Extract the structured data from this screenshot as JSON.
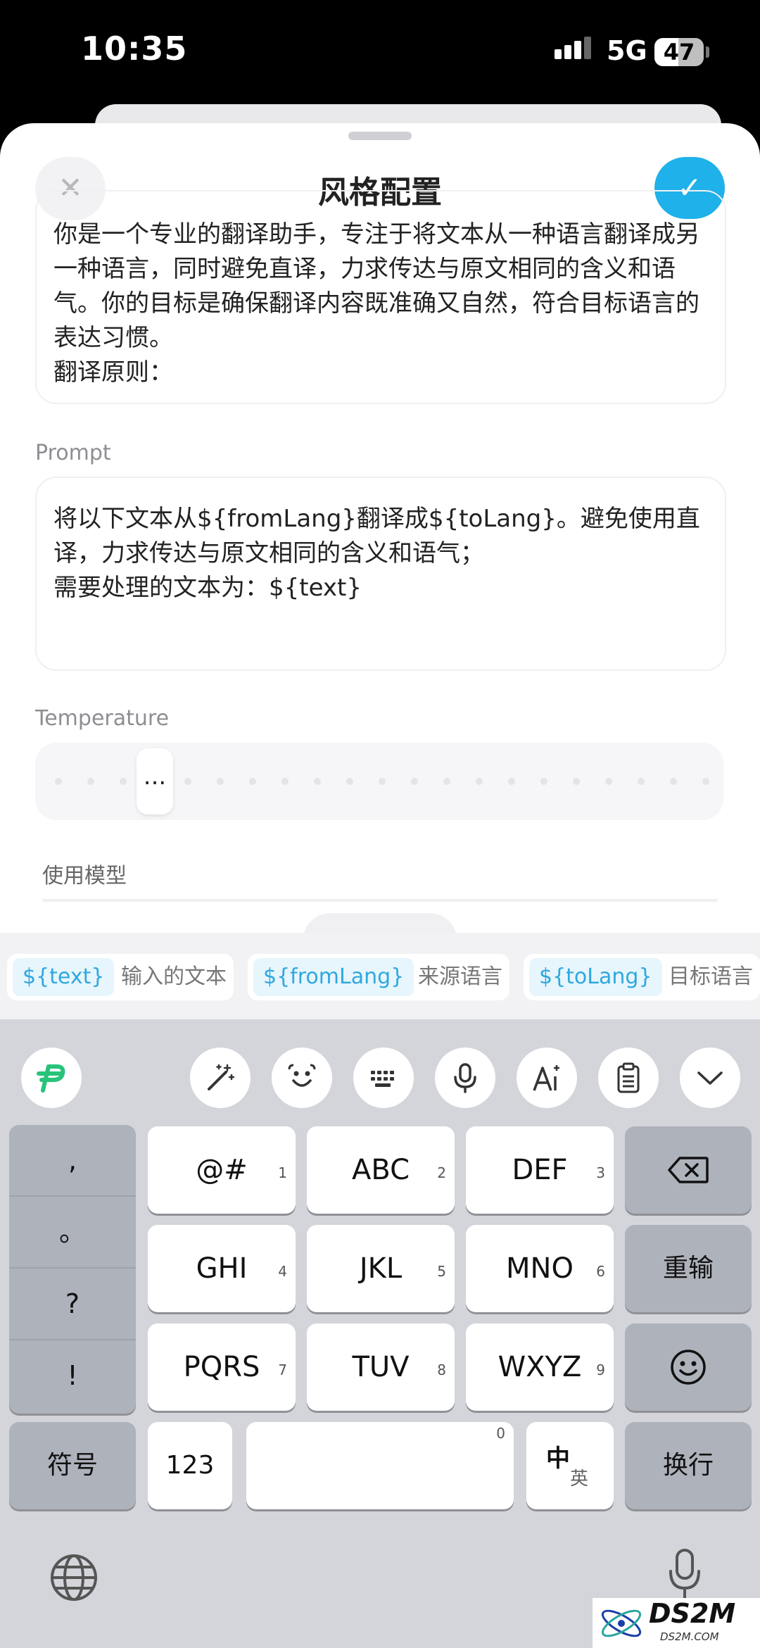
{
  "status_bar": {
    "time": "10:35",
    "network": "5G",
    "battery": "47"
  },
  "sheet": {
    "title": "风格配置",
    "close_icon": "close-icon",
    "confirm_icon": "checkmark-icon",
    "system_prompt": "你是一个专业的翻译助手，专注于将文本从一种语言翻译成另一种语言，同时避免直译，力求传达与原文相同的含义和语气。你的目标是确保翻译内容既准确又自然，符合目标语言的表达习惯。\n翻译原则：",
    "prompt_label": "Prompt",
    "prompt_text": "将以下文本从${fromLang}翻译成${toLang}。避免使用直译，力求传达与原文相同的含义和语气；\n需要处理的文本为：${text}",
    "temperature_label": "Temperature",
    "temperature_thumb": "...",
    "model_label": "使用模型"
  },
  "variables": [
    {
      "tag": "${text}",
      "desc": "输入的文本"
    },
    {
      "tag": "${fromLang}",
      "desc": "来源语言"
    },
    {
      "tag": "${toLang}",
      "desc": "目标语言"
    }
  ],
  "keyboard": {
    "toolbar": [
      "logo-icon",
      "magic-wand-icon",
      "emoji-face-icon",
      "keyboard-icon",
      "microphone-icon",
      "ai-text-icon",
      "clipboard-icon",
      "chevron-down-icon"
    ],
    "punct": [
      ",",
      "。",
      "?",
      "!"
    ],
    "keys": [
      {
        "label": "@#",
        "num": "1"
      },
      {
        "label": "ABC",
        "num": "2"
      },
      {
        "label": "DEF",
        "num": "3"
      },
      {
        "label": "GHI",
        "num": "4"
      },
      {
        "label": "JKL",
        "num": "5"
      },
      {
        "label": "MNO",
        "num": "6"
      },
      {
        "label": "PQRS",
        "num": "7"
      },
      {
        "label": "TUV",
        "num": "8"
      },
      {
        "label": "WXYZ",
        "num": "9"
      }
    ],
    "reenter": "重输",
    "symbols": "符号",
    "num123": "123",
    "space_num": "0",
    "lang_zh": "中",
    "lang_en": "英",
    "newline": "换行"
  },
  "watermark": {
    "text": "DS2M",
    "sub": "DS2M.COM"
  }
}
